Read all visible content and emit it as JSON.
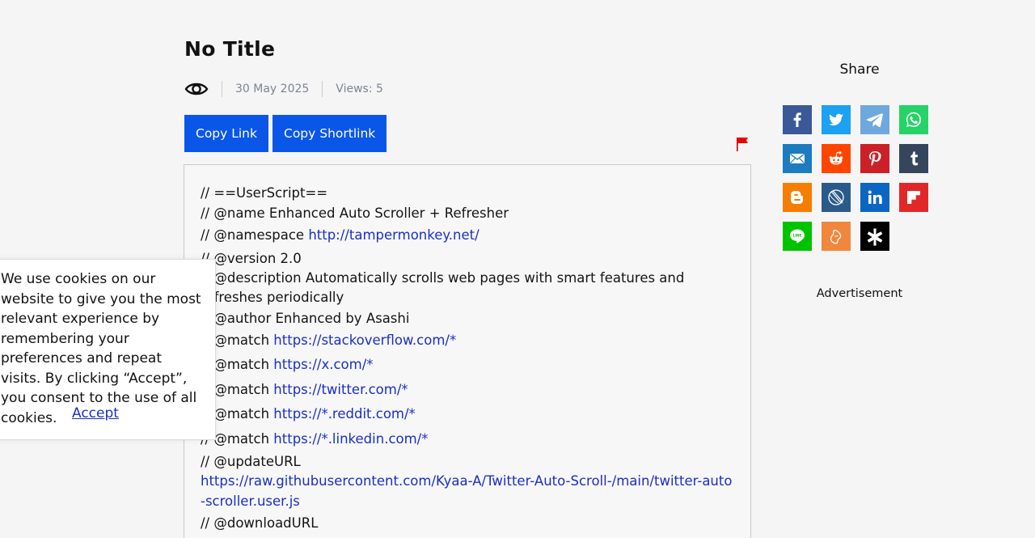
{
  "post": {
    "title": "No Title",
    "date": "30 May 2025",
    "views": "Views: 5"
  },
  "buttons": {
    "copy_link": "Copy Link",
    "copy_shortlink": "Copy Shortlink"
  },
  "code": {
    "lines": [
      {
        "text": "// ==UserScript=="
      },
      {
        "text": "// @name Enhanced Auto Scroller + Refresher"
      },
      {
        "prefix": "// @namespace ",
        "link": "http://tampermonkey.net/"
      },
      {
        "text": "// @version 2.0"
      },
      {
        "text": "// @description Automatically scrolls web pages with smart features and refreshes periodically"
      },
      {
        "text": "// @author Enhanced by Asashi"
      },
      {
        "prefix": "// @match ",
        "link": "https://stackoverflow.com/*"
      },
      {
        "prefix": "// @match ",
        "link": "https://x.com/*"
      },
      {
        "prefix": "// @match ",
        "link": "https://twitter.com/*"
      },
      {
        "prefix": "// @match ",
        "link": "https://*.reddit.com/*"
      },
      {
        "prefix": "// @match ",
        "link": "https://*.linkedin.com/*"
      },
      {
        "text": "// @updateURL"
      },
      {
        "link": "https://raw.githubusercontent.com/Kyaa-A/Twitter-Auto-Scroll-/main/twitter-auto-scroller.user.js"
      },
      {
        "text": "// @downloadURL"
      }
    ]
  },
  "cookie": {
    "message": "We use cookies on our website to give you the most relevant experience by remembering your preferences and repeat visits. By clicking “Accept”, you consent to the use of all cookies.",
    "accept": "Accept"
  },
  "share": {
    "title": "Share",
    "buttons": [
      {
        "name": "facebook",
        "color": "#3b5998"
      },
      {
        "name": "twitter",
        "color": "#1da1f2"
      },
      {
        "name": "telegram",
        "color": "#6fa8dc"
      },
      {
        "name": "whatsapp",
        "color": "#25d366"
      },
      {
        "name": "email",
        "color": "#1d7bbf"
      },
      {
        "name": "reddit",
        "color": "#ff4500"
      },
      {
        "name": "pinterest",
        "color": "#cb2027"
      },
      {
        "name": "tumblr",
        "color": "#35465c"
      },
      {
        "name": "blogger",
        "color": "#f57d00"
      },
      {
        "name": "livejournal",
        "color": "#2a5a8a"
      },
      {
        "name": "linkedin",
        "color": "#0a66c2"
      },
      {
        "name": "flipboard",
        "color": "#e12828"
      },
      {
        "name": "line",
        "color": "#00c300"
      },
      {
        "name": "hatena",
        "color": "#f0873c"
      },
      {
        "name": "asterisk",
        "color": "#000000"
      }
    ]
  },
  "sidebar": {
    "advertisement": "Advertisement"
  }
}
